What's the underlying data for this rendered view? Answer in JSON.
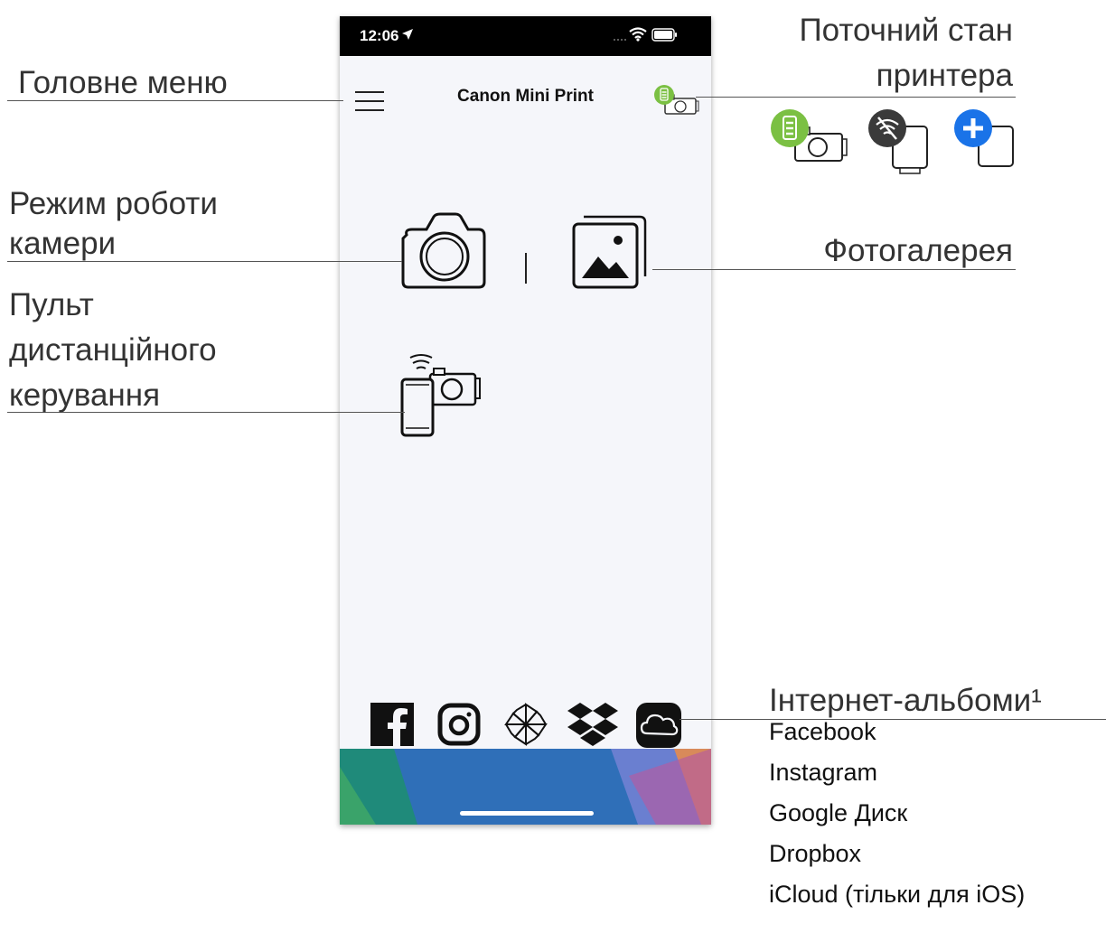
{
  "callouts": {
    "main_menu": "Головне меню",
    "printer_status_line1": "Поточний стан",
    "printer_status_line2": "принтера",
    "camera_mode_line1": "Режим роботи",
    "camera_mode_line2": "камери",
    "gallery": "Фотогалерея",
    "remote_line1": "Пульт",
    "remote_line2": "дистанційного",
    "remote_line3": "керування",
    "social_albums": "Інтернет-альбоми¹"
  },
  "social_album_list": [
    "Facebook",
    "Instagram",
    "Google Диск",
    "Dropbox",
    "iCloud (тільки для iOS)"
  ],
  "app": {
    "status_time": "12:06",
    "title": "Canon Mini Print"
  },
  "colors": {
    "battery_green": "#7bc043",
    "disconnected_gray": "#3a3a3a",
    "add_blue": "#1a73e8"
  },
  "icons": {
    "menu": "hamburger-icon",
    "printer_status": "printer-battery-icon",
    "camera": "camera-icon",
    "gallery": "gallery-icon",
    "remote": "phone-remote-icon",
    "facebook": "facebook-icon",
    "instagram": "instagram-icon",
    "google_drive": "google-drive-icon",
    "dropbox": "dropbox-icon",
    "icloud": "icloud-icon"
  }
}
